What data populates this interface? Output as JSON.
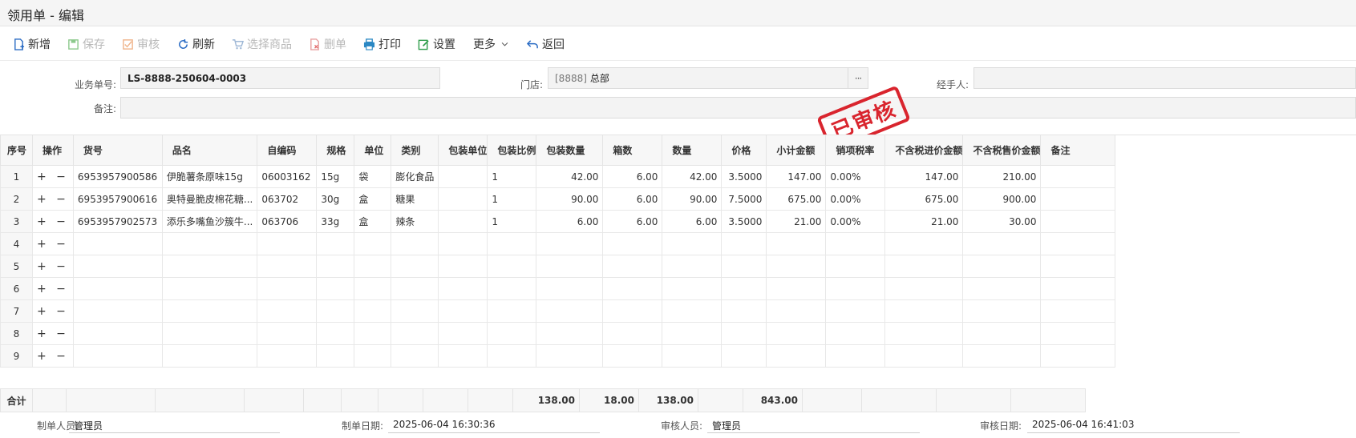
{
  "window": {
    "title": "领用单 - 编辑"
  },
  "toolbar": {
    "new": "新增",
    "save": "保存",
    "audit": "审核",
    "refresh": "刷新",
    "select_goods": "选择商品",
    "delete": "删单",
    "print": "打印",
    "settings": "设置",
    "more": "更多",
    "back": "返回"
  },
  "form": {
    "doc_no_label": "业务单号:",
    "doc_no": "LS-8888-250604-0003",
    "store_label": "门店:",
    "store_code": "[8888]",
    "store_name": "总部",
    "store_btn": "···",
    "handler_label": "经手人:",
    "handler": "",
    "remark_label": "备注:",
    "remark": ""
  },
  "stamp": {
    "text": "已审核",
    "color": "#d9252e"
  },
  "table": {
    "headers": [
      "序号",
      "操作",
      "货号",
      "品名",
      "自编码",
      "规格",
      "单位",
      "类别",
      "包装单位",
      "包装比例",
      "包装数量",
      "箱数",
      "数量",
      "价格",
      "小计金额",
      "销项税率",
      "不含税进价金额",
      "不含税售价金额",
      "备注"
    ],
    "rows": [
      {
        "seq": "1",
        "ops": "+ −",
        "code": "6953957900586",
        "name": "伊脆薯条原味15g",
        "selfcode": "06003162",
        "spec": "15g",
        "unit": "袋",
        "category": "膨化食品",
        "pack_unit": "",
        "pack_ratio": "1",
        "pack_qty": "42.00",
        "boxes": "6.00",
        "qty": "42.00",
        "price": "3.5000",
        "subtotal": "147.00",
        "tax": "0.00%",
        "cost_ex": "147.00",
        "sale_ex": "210.00",
        "remark": ""
      },
      {
        "seq": "2",
        "ops": "+ −",
        "code": "6953957900616",
        "name": "奥特曼脆皮棉花糖...",
        "selfcode": "063702",
        "spec": "30g",
        "unit": "盒",
        "category": "糖果",
        "pack_unit": "",
        "pack_ratio": "1",
        "pack_qty": "90.00",
        "boxes": "6.00",
        "qty": "90.00",
        "price": "7.5000",
        "subtotal": "675.00",
        "tax": "0.00%",
        "cost_ex": "675.00",
        "sale_ex": "900.00",
        "remark": ""
      },
      {
        "seq": "3",
        "ops": "+ −",
        "code": "6953957902573",
        "name": "添乐多嘴鱼沙簇牛...",
        "selfcode": "063706",
        "spec": "33g",
        "unit": "盒",
        "category": "辣条",
        "pack_unit": "",
        "pack_ratio": "1",
        "pack_qty": "6.00",
        "boxes": "6.00",
        "qty": "6.00",
        "price": "3.5000",
        "subtotal": "21.00",
        "tax": "0.00%",
        "cost_ex": "21.00",
        "sale_ex": "30.00",
        "remark": ""
      },
      {
        "seq": "4",
        "ops": "+ −"
      },
      {
        "seq": "5",
        "ops": "+ −"
      },
      {
        "seq": "6",
        "ops": "+ −"
      },
      {
        "seq": "7",
        "ops": "+ −"
      },
      {
        "seq": "8",
        "ops": "+ −"
      },
      {
        "seq": "9",
        "ops": "+ −"
      }
    ]
  },
  "totals": {
    "label": "合计",
    "pack_qty": "138.00",
    "boxes": "18.00",
    "qty": "138.00",
    "subtotal": "843.00"
  },
  "footer": {
    "creator_label": "制单人员:",
    "creator": "管理员",
    "created_label": "制单日期:",
    "created": "2025-06-04 16:30:36",
    "auditor_label": "审核人员:",
    "auditor": "管理员",
    "audited_label": "审核日期:",
    "audited": "2025-06-04 16:41:03"
  }
}
